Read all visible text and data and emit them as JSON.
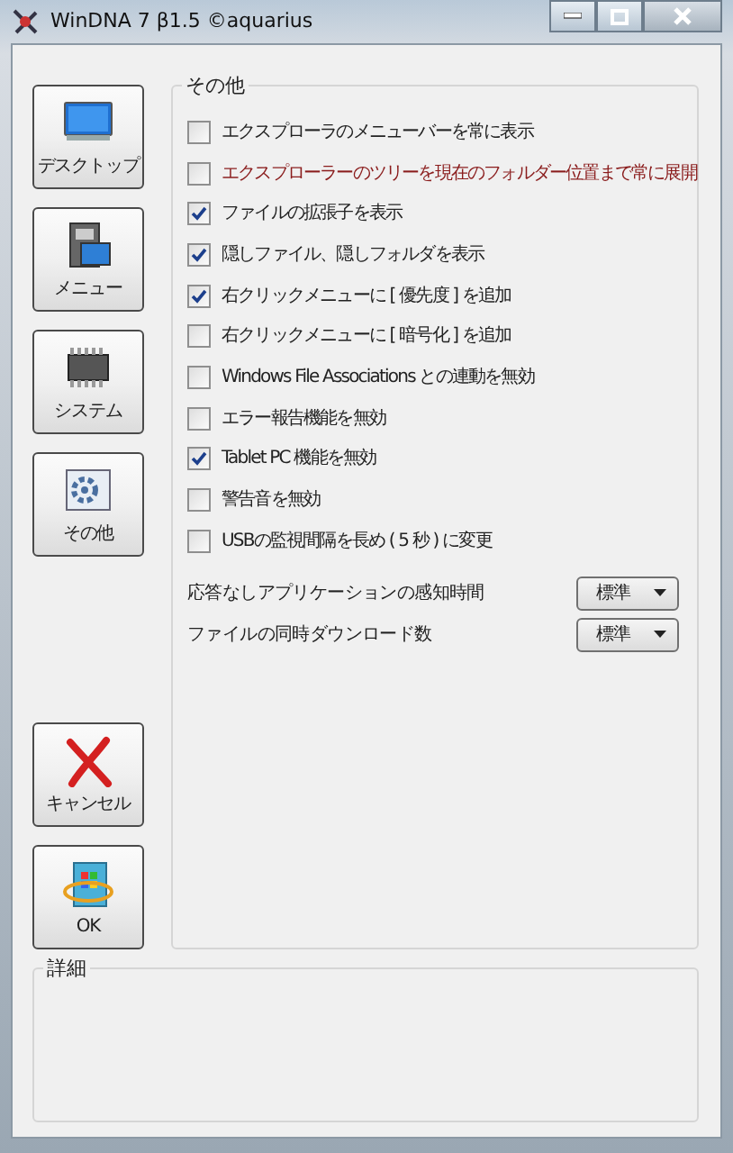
{
  "window": {
    "title": "WinDNA 7 β1.5 ©aquarius"
  },
  "sidebar": {
    "items": [
      {
        "label": "デスクトップ",
        "kind": "desktop"
      },
      {
        "label": "メニュー",
        "kind": "menu"
      },
      {
        "label": "システム",
        "kind": "system"
      },
      {
        "label": "その他",
        "kind": "other"
      }
    ]
  },
  "options": {
    "title": "その他",
    "checkboxes": [
      {
        "label": "エクスプローラのメニューバーを常に表示",
        "checked": false,
        "color": "#222222"
      },
      {
        "label": "エクスプローラーのツリーを現在のフォルダー位置まで常に展開",
        "checked": false,
        "color": "#8a1c1c"
      },
      {
        "label": "ファイルの拡張子を表示",
        "checked": true,
        "color": "#222222"
      },
      {
        "label": "隠しファイル、隠しフォルダを表示",
        "checked": true,
        "color": "#222222"
      },
      {
        "label": "右クリックメニューに [ 優先度 ] を追加",
        "checked": true,
        "color": "#222222"
      },
      {
        "label": "右クリックメニューに [ 暗号化 ] を追加",
        "checked": false,
        "color": "#222222"
      },
      {
        "label": "Windows File Associations との連動を無効",
        "checked": false,
        "color": "#222222"
      },
      {
        "label": "エラー報告機能を無効",
        "checked": false,
        "color": "#222222"
      },
      {
        "label": "Tablet PC 機能を無効",
        "checked": true,
        "color": "#222222"
      },
      {
        "label": "警告音を無効",
        "checked": false,
        "color": "#222222"
      },
      {
        "label": "USBの監視間隔を長め ( 5 秒 ) に変更",
        "checked": false,
        "color": "#222222"
      }
    ],
    "dropdowns": [
      {
        "label": "応答なしアプリケーションの感知時間",
        "value": "標準"
      },
      {
        "label": "ファイルの同時ダウンロード数",
        "value": "標準"
      }
    ]
  },
  "actions": [
    {
      "label": "キャンセル",
      "kind": "cancel"
    },
    {
      "label": "OK",
      "kind": "ok"
    }
  ],
  "details": {
    "title": "詳細"
  }
}
